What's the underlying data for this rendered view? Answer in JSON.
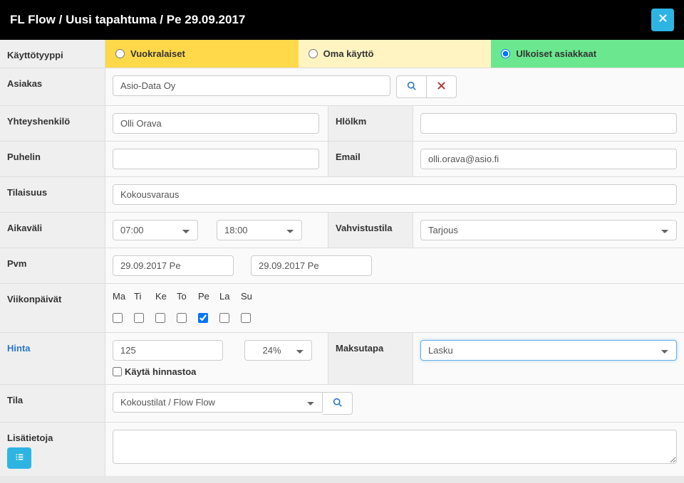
{
  "header": {
    "title": "FL Flow / Uusi tapahtuma / Pe 29.09.2017"
  },
  "labels": {
    "kayttotyyppi": "Käyttötyyppi",
    "asiakas": "Asiakas",
    "yhteyshenkilo": "Yhteyshenkilö",
    "hlolkm": "Hlölkm",
    "puhelin": "Puhelin",
    "email": "Email",
    "tilaisuus": "Tilaisuus",
    "aikavali": "Aikaväli",
    "vahvistustila": "Vahvistustila",
    "pvm": "Pvm",
    "viikonpaivat": "Viikonpäivät",
    "hinta": "Hinta",
    "kayta_hinnastoa": "Käytä hinnastoa",
    "maksutapa": "Maksutapa",
    "tila": "Tila",
    "lisatietoja": "Lisätietoja"
  },
  "userTypes": {
    "vuokralaiset": "Vuokralaiset",
    "omakaytto": "Oma käyttö",
    "ulkoiset": "Ulkoiset asiakkaat",
    "selected": "ulkoiset"
  },
  "asiakas": {
    "value": "Asio-Data Oy"
  },
  "yhteyshenkilo": {
    "value": "Olli Orava"
  },
  "hlolkm": {
    "value": ""
  },
  "puhelin": {
    "value": ""
  },
  "email": {
    "value": "olli.orava@asio.fi"
  },
  "tilaisuus": {
    "value": "Kokousvaraus"
  },
  "aikavali": {
    "start": "07:00",
    "end": "18:00"
  },
  "vahvistustila": {
    "selected": "Tarjous"
  },
  "pvm": {
    "start": "29.09.2017 Pe",
    "end": "29.09.2017 Pe"
  },
  "weekdays": {
    "labels": [
      "Ma",
      "Ti",
      "Ke",
      "To",
      "Pe",
      "La",
      "Su"
    ],
    "checked": [
      false,
      false,
      false,
      false,
      true,
      false,
      false
    ]
  },
  "hinta": {
    "value": "125",
    "vat": "24%",
    "usePricelist": false
  },
  "maksutapa": {
    "selected": "Lasku"
  },
  "tila": {
    "selected": "Kokoustilat / Flow Flow"
  },
  "lisatietoja": {
    "value": ""
  }
}
